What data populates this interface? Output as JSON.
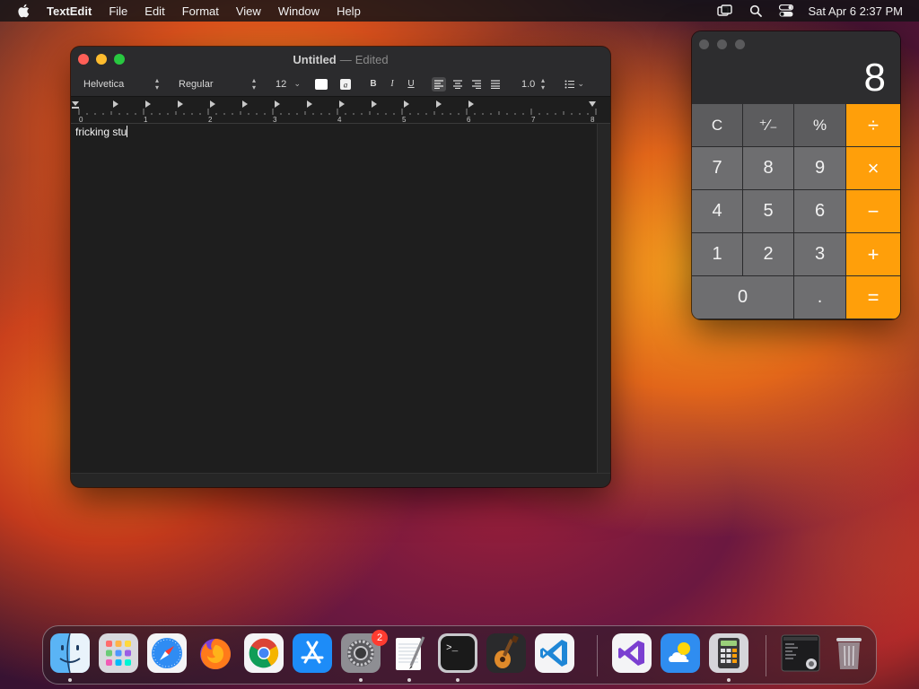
{
  "menubar": {
    "apple_icon": "apple-icon",
    "app_name": "TextEdit",
    "items": [
      "File",
      "Edit",
      "Format",
      "View",
      "Window",
      "Help"
    ],
    "status_icons": [
      "screen-mirroring-icon",
      "spotlight-search-icon",
      "control-center-icon"
    ],
    "clock": "Sat Apr 6  2:37 PM"
  },
  "textedit": {
    "title": "Untitled",
    "title_separator": "—",
    "title_status": "Edited",
    "toolbar": {
      "font_family": "Helvetica",
      "font_style": "Regular",
      "font_size": "12",
      "text_color": "#ffffff",
      "line_spacing": "1.0"
    },
    "ruler_labels": [
      "0",
      "1",
      "2",
      "3",
      "4",
      "5",
      "6",
      "7",
      "8"
    ],
    "document_text": "fricking stu"
  },
  "calculator": {
    "display": "8",
    "keys": [
      [
        "C",
        "⁺∕₋",
        "%",
        "÷"
      ],
      [
        "7",
        "8",
        "9",
        "×"
      ],
      [
        "4",
        "5",
        "6",
        "−"
      ],
      [
        "1",
        "2",
        "3",
        "+"
      ],
      [
        "0",
        ".",
        "="
      ]
    ],
    "operator_color": "#ff9f0a"
  },
  "dock": {
    "apps": [
      "finder",
      "launchpad",
      "safari",
      "firefox",
      "chrome",
      "app-store",
      "system-settings",
      "textedit",
      "terminal",
      "garageband",
      "vscode",
      "visual-studio",
      "weather",
      "calculator",
      "recent-window",
      "trash"
    ],
    "system_settings_badge": "2"
  }
}
